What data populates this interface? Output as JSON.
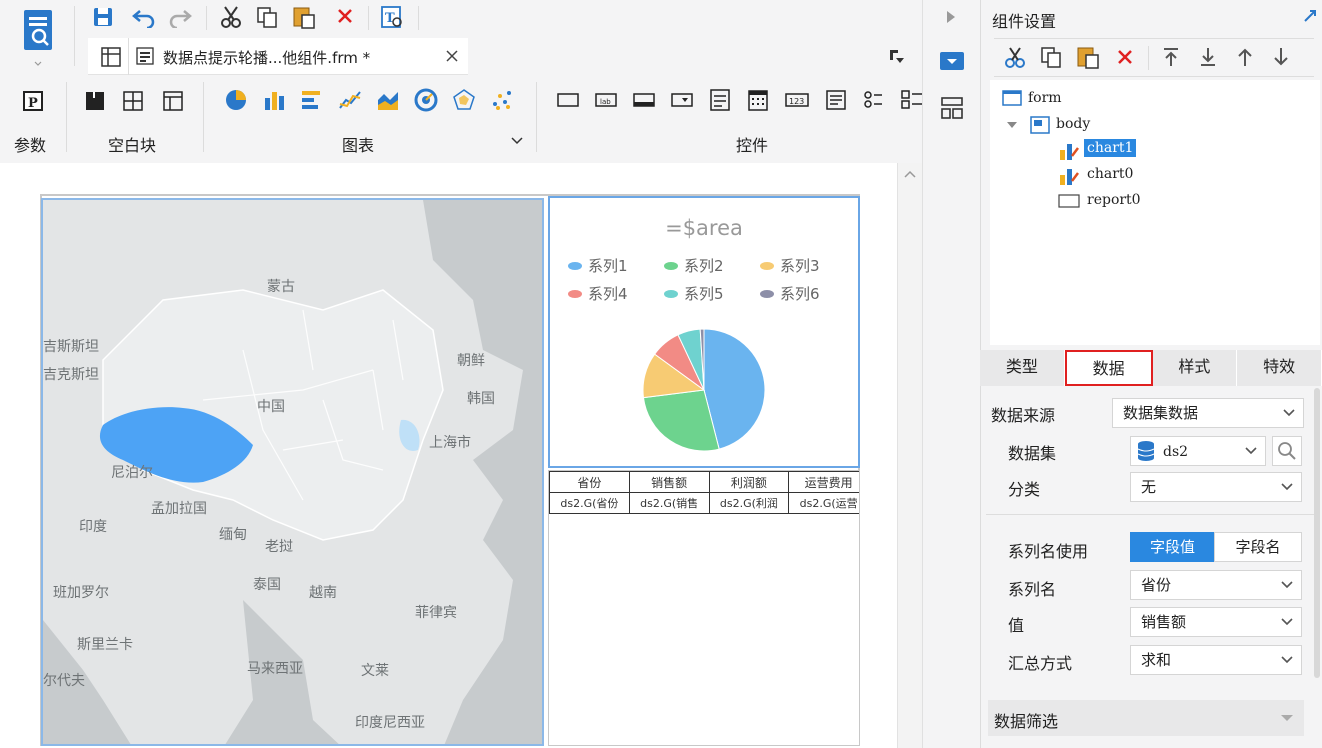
{
  "header": {
    "tab_title": "数据点提示轮播...他组件.frm *",
    "groups": {
      "param": "参数",
      "blank": "空白块",
      "chart": "图表",
      "control": "控件"
    }
  },
  "panel": {
    "title": "组件设置",
    "tree": {
      "form": "form",
      "body": "body",
      "chart1": "chart1",
      "chart0": "chart0",
      "report0": "report0"
    },
    "tabs": [
      "类型",
      "数据",
      "样式",
      "特效"
    ],
    "fields": {
      "data_source_label": "数据来源",
      "data_source_value": "数据集数据",
      "dataset_label": "数据集",
      "dataset_value": "ds2",
      "category_label": "分类",
      "category_value": "无",
      "series_name_use_label": "系列名使用",
      "seg_field_value": "字段值",
      "seg_field_name": "字段名",
      "series_name_label": "系列名",
      "series_name_value": "省份",
      "value_label": "值",
      "value_value": "销售额",
      "agg_label": "汇总方式",
      "agg_value": "求和",
      "filter_label": "数据筛选"
    }
  },
  "map": {
    "labels": [
      "蒙古",
      "吉斯斯坦",
      "吉克斯坦",
      "朝鲜",
      "中国",
      "韩国",
      "上海市",
      "尼泊尔",
      "孟加拉国",
      "印度",
      "缅甸",
      "老挝",
      "泰国",
      "越南",
      "菲律宾",
      "班加罗尔",
      "斯里兰卡",
      "马来西亚",
      "文莱",
      "印度尼西亚",
      "尔代夫"
    ],
    "highlight_color": "#4da3f5"
  },
  "chart_data": {
    "type": "pie",
    "title": "=$area",
    "series": [
      {
        "name": "系列1",
        "color": "#6ab4ef",
        "value": 0.46
      },
      {
        "name": "系列2",
        "color": "#6dd38e",
        "value": 0.27
      },
      {
        "name": "系列3",
        "color": "#f7cb73",
        "value": 0.12
      },
      {
        "name": "系列4",
        "color": "#f28b85",
        "value": 0.08
      },
      {
        "name": "系列5",
        "color": "#6fd2cf",
        "value": 0.06
      },
      {
        "name": "系列6",
        "color": "#8d8fa8",
        "value": 0.01
      }
    ]
  },
  "report": {
    "headers": [
      "省份",
      "销售额",
      "利润额",
      "运营费用"
    ],
    "cells": [
      "ds2.G(省份",
      "ds2.G(销售",
      "ds2.G(利润",
      "ds2.G(运营"
    ]
  }
}
